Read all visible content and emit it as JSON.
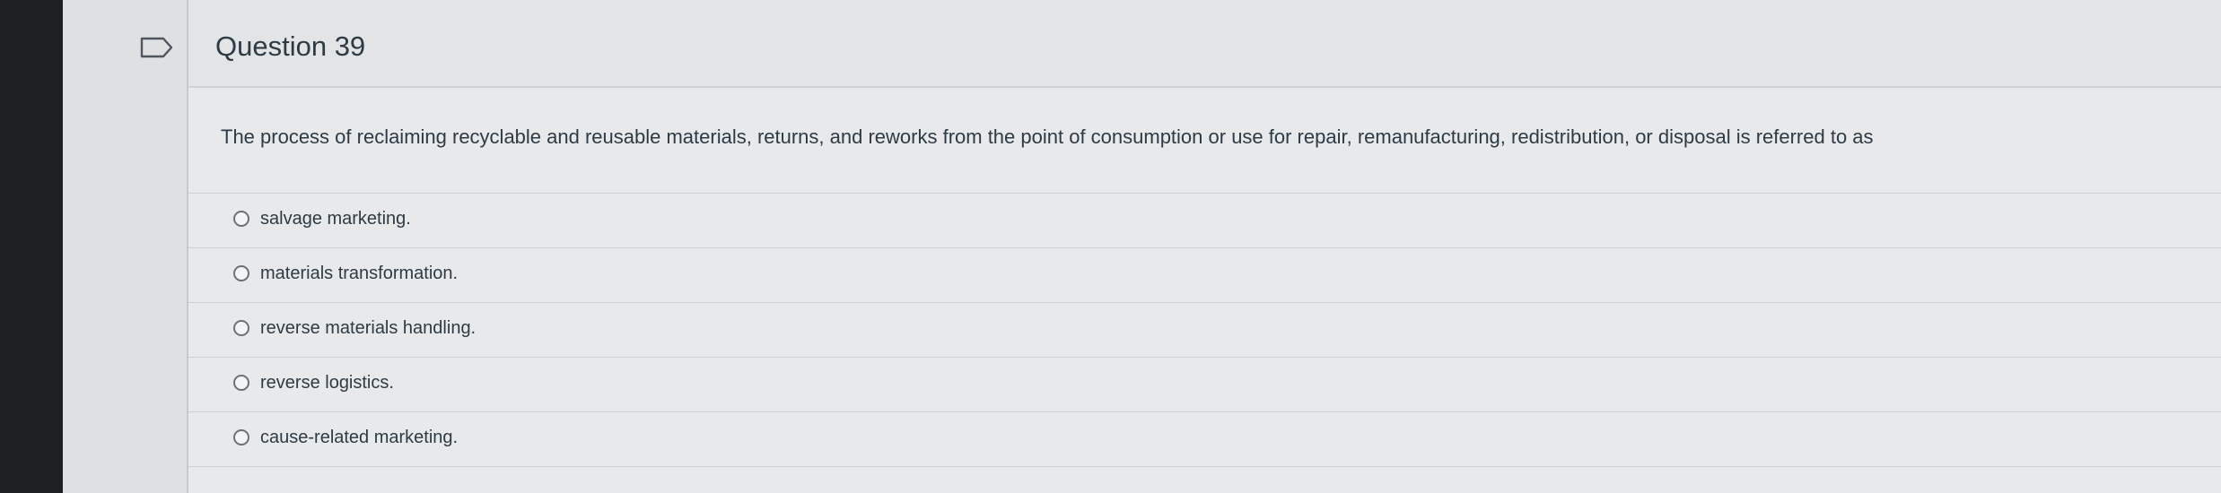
{
  "question": {
    "title": "Question 39",
    "text": "The process of reclaiming recyclable and reusable materials, returns, and reworks from the point of consumption or use for repair, remanufacturing, redistribution, or disposal is referred to as",
    "options": [
      {
        "label": "salvage marketing."
      },
      {
        "label": "materials transformation."
      },
      {
        "label": "reverse materials handling."
      },
      {
        "label": "reverse logistics."
      },
      {
        "label": "cause-related marketing."
      }
    ],
    "flag_icon": "bookmark-flag-icon"
  }
}
